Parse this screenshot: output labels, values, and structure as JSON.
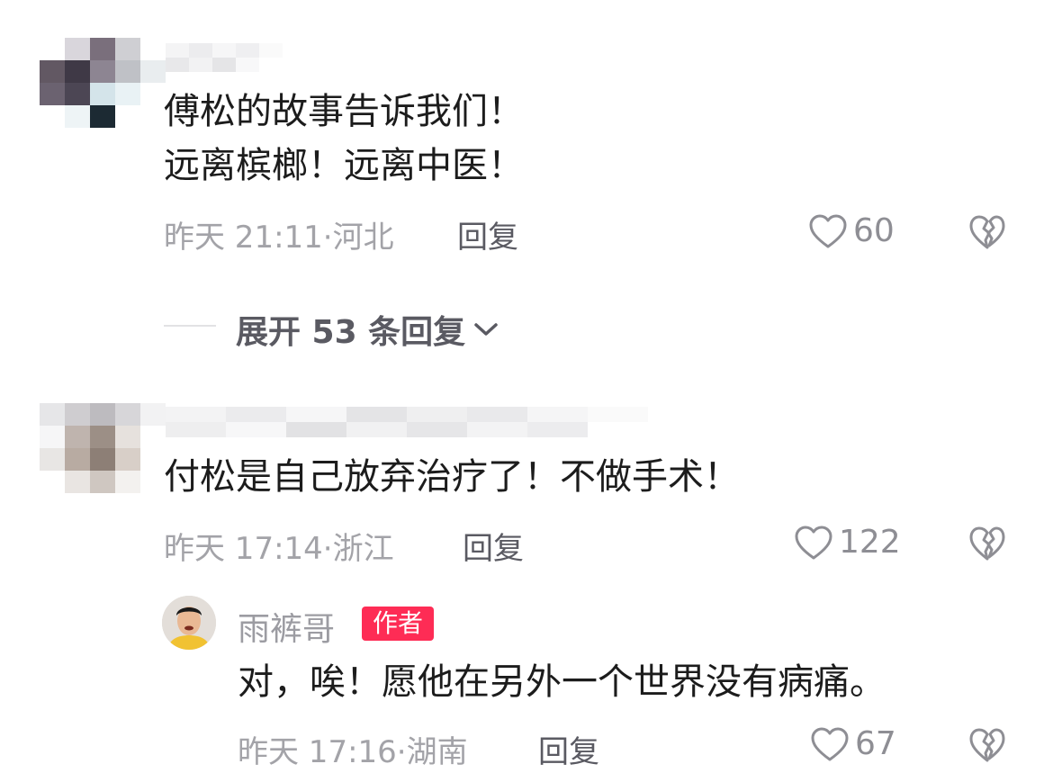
{
  "comments": [
    {
      "text_lines": [
        "傅松的故事告诉我们！",
        "远离槟榔！远离中医！"
      ],
      "time": "昨天 21:11",
      "location": "河北",
      "reply_label": "回复",
      "likes": "60",
      "expand_label": "展开 53 条回复"
    },
    {
      "text_lines": [
        "付松是自己放弃治疗了！不做手术！"
      ],
      "time": "昨天 17:14",
      "location": "浙江",
      "reply_label": "回复",
      "likes": "122",
      "reply": {
        "username": "雨裤哥",
        "badge": "作者",
        "text": "对，唉！愿他在另外一个世界没有病痛。",
        "time": "昨天 17:16",
        "location": "湖南",
        "reply_label": "回复",
        "likes": "67"
      }
    }
  ],
  "icons": {
    "like": "heart-outline-icon",
    "dislike": "broken-heart-icon",
    "expand": "chevron-down-icon"
  },
  "colors": {
    "badge": "#fe2c55",
    "meta": "#a3a3a8"
  }
}
